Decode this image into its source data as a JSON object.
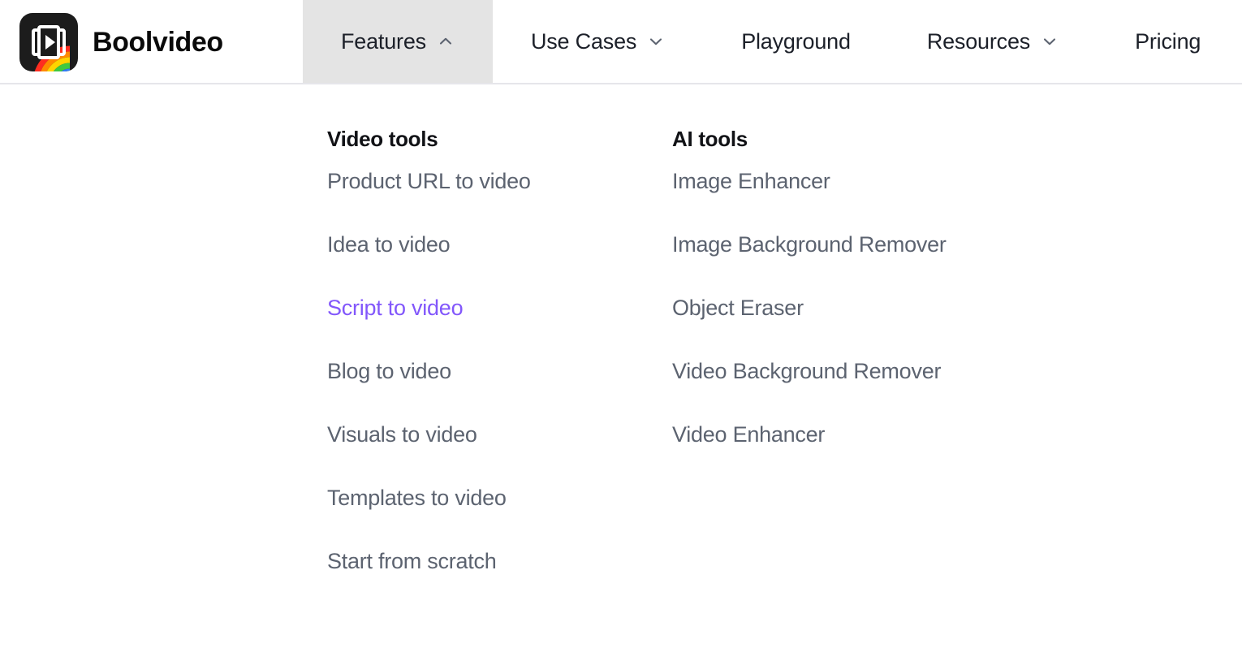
{
  "brand": {
    "name": "Boolvideo",
    "logo_icon": "boolvideo-logo-icon",
    "logo_colors": {
      "background": "#1c1c1c",
      "rainbow": [
        "#ff2d20",
        "#ff8a00",
        "#ffd400",
        "#3fc93f",
        "#2f7df6",
        "#a06bf2"
      ]
    }
  },
  "nav": {
    "items": [
      {
        "label": "Features",
        "icon": "chevron-up-icon",
        "has_chevron": true,
        "active": true,
        "expanded": true
      },
      {
        "label": "Use Cases",
        "icon": "chevron-down-icon",
        "has_chevron": true,
        "active": false,
        "expanded": false
      },
      {
        "label": "Playground",
        "icon": "",
        "has_chevron": false,
        "active": false,
        "expanded": false
      },
      {
        "label": "Resources",
        "icon": "chevron-down-icon",
        "has_chevron": true,
        "active": false,
        "expanded": false
      },
      {
        "label": "Pricing",
        "icon": "",
        "has_chevron": false,
        "active": false,
        "expanded": false
      }
    ]
  },
  "dropdown": {
    "columns": [
      {
        "heading": "Video tools",
        "items": [
          {
            "label": "Product URL to video",
            "selected": false
          },
          {
            "label": "Idea to video",
            "selected": false
          },
          {
            "label": "Script to video",
            "selected": true
          },
          {
            "label": "Blog to video",
            "selected": false
          },
          {
            "label": "Visuals to video",
            "selected": false
          },
          {
            "label": "Templates to video",
            "selected": false
          },
          {
            "label": "Start from scratch",
            "selected": false
          }
        ]
      },
      {
        "heading": "AI tools",
        "items": [
          {
            "label": "Image Enhancer",
            "selected": false
          },
          {
            "label": "Image Background Remover",
            "selected": false
          },
          {
            "label": "Object Eraser",
            "selected": false
          },
          {
            "label": "Video Background Remover",
            "selected": false
          },
          {
            "label": "Video Enhancer",
            "selected": false
          }
        ]
      }
    ]
  },
  "colors": {
    "accent_purple": "#8257fb",
    "text_dark": "#1c2029",
    "text_muted": "#5c6370",
    "active_tab_bg": "#e4e4e4",
    "header_border": "#e6e6ea",
    "page_bg": "#ffffff"
  }
}
